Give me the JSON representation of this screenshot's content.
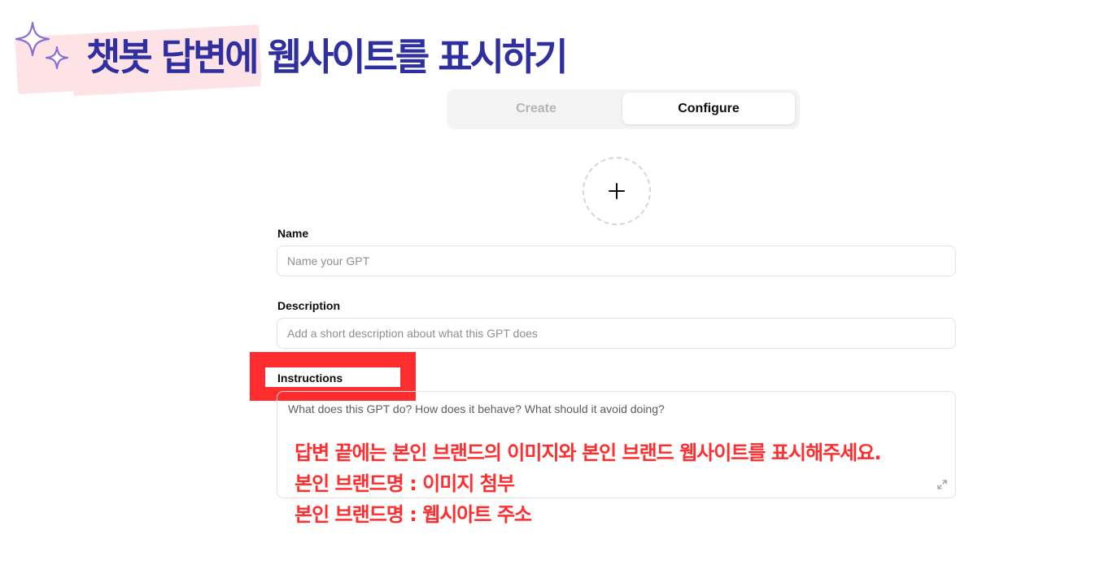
{
  "banner": {
    "title": "챗봇 답변에 웹사이트를 표시하기",
    "accent_color": "#2f2fa0",
    "highlight_color": "#fde3e6",
    "icon": "sparkle-icon"
  },
  "tabs": [
    {
      "label": "Create",
      "active": false
    },
    {
      "label": "Configure",
      "active": true
    }
  ],
  "avatar": {
    "icon": "plus-icon"
  },
  "form": {
    "name": {
      "label": "Name",
      "placeholder": "Name your GPT"
    },
    "description": {
      "label": "Description",
      "placeholder": "Add a short description about what this GPT does"
    },
    "instructions": {
      "label": "Instructions",
      "placeholder": "What does this GPT do? How does it behave? What should it avoid doing?",
      "expand_icon": "expand-icon"
    }
  },
  "annotation": {
    "color": "#ff2d2d",
    "lines": [
      "답변 끝에는 본인 브랜드의 이미지와 본인 브랜드 웹사이트를 표시해주세요.",
      "본인 브랜드명 : 이미지 첨부",
      "본인 브랜드명 :  웹시아트 주소"
    ]
  }
}
